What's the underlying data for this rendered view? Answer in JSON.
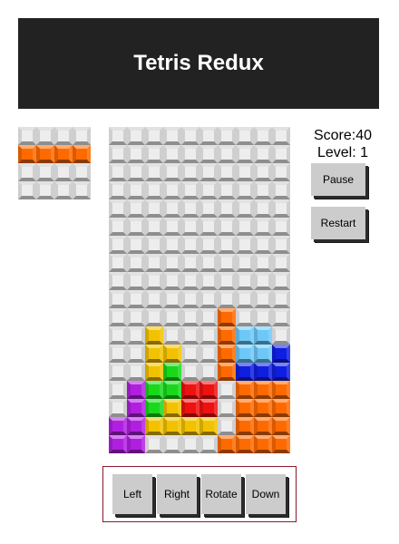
{
  "header": {
    "title": "Tetris Redux"
  },
  "stats": {
    "score": "Score:40",
    "level": "Level: 1"
  },
  "buttons": {
    "pause": "Pause",
    "restart": "Restart"
  },
  "controls": {
    "left": "Left",
    "right": "Right",
    "rotate": "Rotate",
    "down": "Down"
  },
  "colors": {
    "empty": "#ececec",
    "orange": "#ff6a00",
    "yellow": "#f2c200",
    "green": "#19d81c",
    "red": "#ee1111",
    "purple": "#b01fe0",
    "blue": "#0f1ee0",
    "cyan": "#6dc8f7"
  },
  "preview_piece": {
    "rows": 4,
    "cols": 4,
    "grid": [
      "....",
      "IIII",
      "....",
      "...."
    ]
  },
  "board": {
    "rows": 18,
    "cols": 10,
    "grid": [
      "..........",
      "..........",
      "..........",
      "..........",
      "..........",
      "..........",
      "..........",
      "..........",
      "..........",
      "..........",
      "......O...",
      "..Y...OCC.",
      "..YY..OCCB",
      "..YG..OBBB",
      ".PGGRR.OOO",
      ".PGYRR.OOO",
      "PPYYYY.OOO",
      "PP....OOOO"
    ]
  }
}
